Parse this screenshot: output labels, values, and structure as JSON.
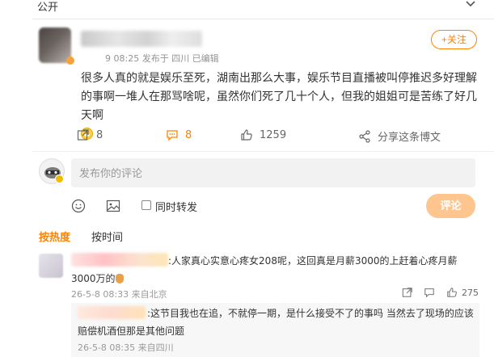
{
  "top": {
    "visibility_label": "公开"
  },
  "post": {
    "meta": "9 08:25 发布于 四川 已编辑",
    "follow_label": "+关注",
    "text": "很多人真的就是娱乐至死，湖南出那么大事，娱乐节目直播被叫停推迟多好理解的事啊一堆人在那骂啥呢，虽然你们死了几十个人，但我的姐姐可是苦练了好几天啊",
    "actions": {
      "forward_count": "8",
      "comment_count": "8",
      "like_count": "1259",
      "share_label": "分享这条博文"
    }
  },
  "composer": {
    "placeholder": "发布你的评论",
    "repost_label": "同时转发",
    "submit_label": "评论"
  },
  "sort_tabs": {
    "hot": "按热度",
    "time": "按时间"
  },
  "comments": [
    {
      "text": ":人家真心实意心疼女208呢，这回真是月薪3000的上赶着心疼月薪3000万的",
      "meta": "26-5-8 08:33 来自北京",
      "likes": "275",
      "reply": {
        "text": ":这节目我也在追，不就停一期，是什么接受不了的事吗 当然去了现场的应该赔偿机酒但那是其他问题",
        "meta": "26-5-8 08:35 来自四川"
      }
    }
  ],
  "colors": {
    "accent": "#ff8200",
    "submit_bg": "#ffc58f"
  }
}
